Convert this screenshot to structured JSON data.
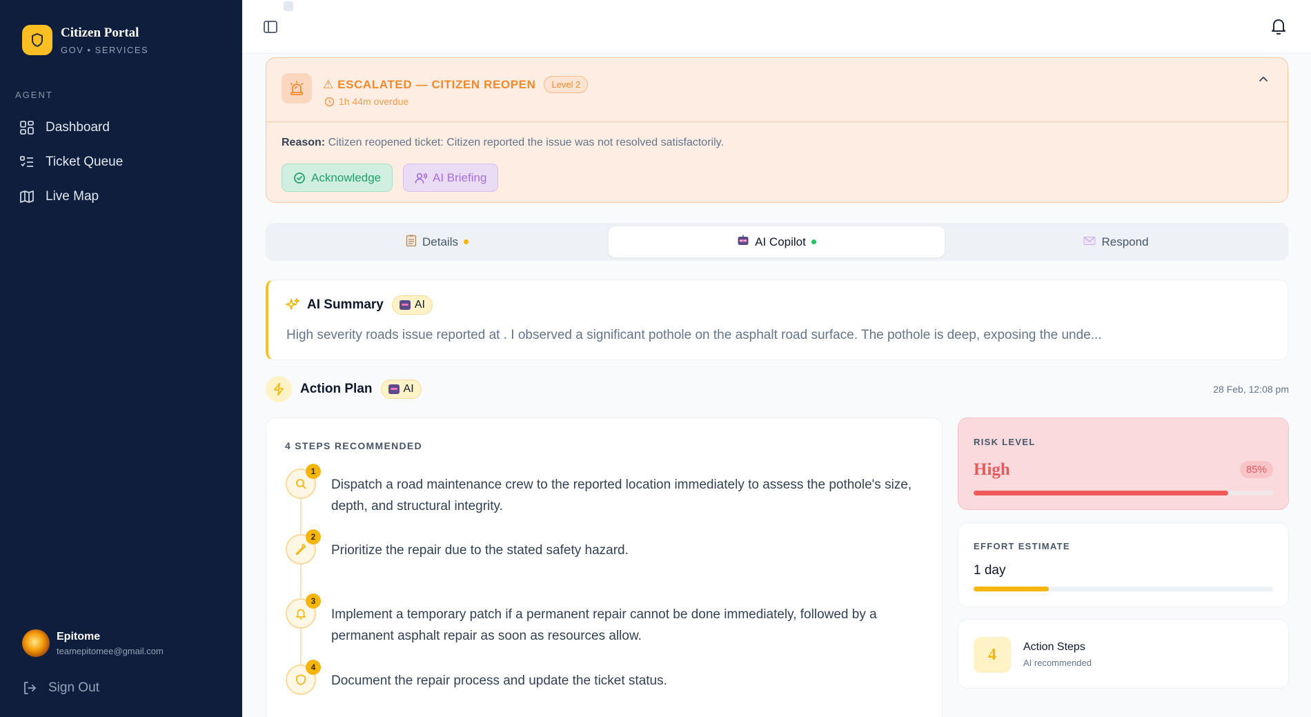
{
  "sidebar": {
    "brand_title": "Citizen Portal",
    "brand_subtitle": "GOV • SERVICES",
    "section_label": "AGENT",
    "items": [
      {
        "label": "Dashboard",
        "icon": "grid-icon"
      },
      {
        "label": "Ticket Queue",
        "icon": "list-icon"
      },
      {
        "label": "Live Map",
        "icon": "map-icon"
      }
    ],
    "user": {
      "name": "Epitome",
      "email": "teamepitomee@gmail.com"
    },
    "sign_out": "Sign Out"
  },
  "escalation": {
    "title": "⚠ ESCALATED — CITIZEN REOPEN",
    "level": "Level 2",
    "overdue": "1h 44m overdue",
    "reason_label": "Reason:",
    "reason_text": " Citizen reopened ticket: Citizen reported the issue was not resolved satisfactorily.",
    "acknowledge_label": "Acknowledge",
    "briefing_label": "AI Briefing"
  },
  "tabs": [
    {
      "label": "Details",
      "dot_color": "#f5b50b",
      "active": false
    },
    {
      "label": "AI Copilot",
      "dot_color": "#22c55e",
      "active": true
    },
    {
      "label": "Respond",
      "dot_color": "",
      "active": false
    }
  ],
  "summary": {
    "title": "AI Summary",
    "badge": "AI",
    "text": "High severity roads issue reported at . I observed a significant pothole on the asphalt road surface. The pothole is deep, exposing the unde..."
  },
  "action_plan": {
    "title": "Action Plan",
    "badge": "AI",
    "timestamp": "28 Feb, 12:08 pm",
    "steps_label": "4 STEPS RECOMMENDED",
    "steps": [
      {
        "num": "1",
        "icon": "search-icon",
        "text": "Dispatch a road maintenance crew to the reported location immediately to assess the pothole's size, depth, and structural integrity."
      },
      {
        "num": "2",
        "icon": "wrench-icon",
        "text": "Prioritize the repair due to the stated safety hazard."
      },
      {
        "num": "3",
        "icon": "bell-icon",
        "text": "Implement a temporary patch if a permanent repair cannot be done immediately, followed by a permanent asphalt repair as soon as resources allow."
      },
      {
        "num": "4",
        "icon": "shield-icon",
        "text": "Document the repair process and update the ticket status."
      }
    ]
  },
  "risk": {
    "label": "RISK LEVEL",
    "value": "High",
    "percent_label": "85%",
    "percent": 85,
    "color": "#ef5b5b"
  },
  "effort": {
    "label": "EFFORT ESTIMATE",
    "value": "1 day",
    "fill_percent": 25,
    "color": "#f5b50b"
  },
  "steps_count": {
    "count": "4",
    "title": "Action Steps",
    "subtitle": "AI recommended"
  },
  "colors": {
    "sidebar_bg": "#0f1e3d",
    "accent": "#fbbf24",
    "escalation_text": "#f08a2a"
  }
}
